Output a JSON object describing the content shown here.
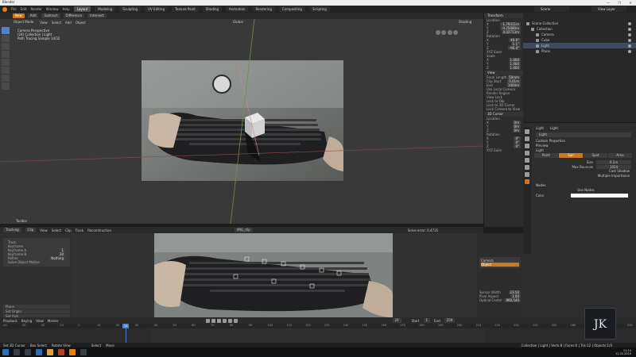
{
  "window": {
    "title": "Blender",
    "controls": [
      "—",
      "❐",
      "✕"
    ]
  },
  "menubar": {
    "menus": [
      "File",
      "Edit",
      "Render",
      "Window",
      "Help"
    ],
    "workspaces": [
      "Layout",
      "Modeling",
      "Sculpting",
      "UV Editing",
      "Texture Paint",
      "Shading",
      "Animation",
      "Rendering",
      "Compositing",
      "Scripting"
    ],
    "active_workspace": "Layout",
    "scene": "Scene",
    "view_layer": "View Layer"
  },
  "viewport_header": {
    "mode": "Object Mode",
    "menus": [
      "View",
      "Select",
      "Add",
      "Object"
    ],
    "transform": "Global",
    "shading": "Shading"
  },
  "viewport": {
    "info_lines": [
      "Camera Perspective",
      "(24) Collection | Light",
      "Path Tracing Sample 14/32"
    ],
    "toolbar_label": "Toolbar"
  },
  "npanel": {
    "sections": [
      {
        "title": "Transform",
        "rows": [
          {
            "label": "Location",
            "value": ""
          },
          {
            "label": "X",
            "value": "-1.79311m"
          },
          {
            "label": "Y",
            "value": "-0.25080m"
          },
          {
            "label": "Z",
            "value": "0.02713m"
          },
          {
            "label": "Rotation",
            "value": ""
          },
          {
            "label": "X",
            "value": "49.6°"
          },
          {
            "label": "Y",
            "value": "1.1°"
          },
          {
            "label": "Z",
            "value": "-96.4°"
          },
          {
            "label": "XYZ Euler",
            "value": ""
          },
          {
            "label": "Scale",
            "value": ""
          },
          {
            "label": "X",
            "value": "1.000"
          },
          {
            "label": "Y",
            "value": "1.000"
          },
          {
            "label": "Z",
            "value": "1.000"
          }
        ]
      },
      {
        "title": "View",
        "rows": [
          {
            "label": "Focal Length",
            "value": "50mm"
          },
          {
            "label": "Clip Start",
            "value": "0.01m"
          },
          {
            "label": "End",
            "value": "1000m"
          },
          {
            "label": "Use Local Camera",
            "value": ""
          },
          {
            "label": "Render Region",
            "value": ""
          },
          {
            "label": "View Lock",
            "value": ""
          },
          {
            "label": "Lock to Obj",
            "value": ""
          },
          {
            "label": "Lock to 3D Cursor",
            "value": ""
          },
          {
            "label": "Lock Camera to View",
            "value": ""
          }
        ]
      },
      {
        "title": "3D Cursor",
        "rows": [
          {
            "label": "Location",
            "value": ""
          },
          {
            "label": "X",
            "value": "0m"
          },
          {
            "label": "Y",
            "value": "0m"
          },
          {
            "label": "Z",
            "value": "0m"
          },
          {
            "label": "Rotation",
            "value": ""
          },
          {
            "label": "X",
            "value": "0°"
          },
          {
            "label": "Y",
            "value": "0°"
          },
          {
            "label": "Z",
            "value": "0°"
          },
          {
            "label": "XYZ Euler",
            "value": ""
          }
        ]
      }
    ]
  },
  "outliner": {
    "rows": [
      {
        "name": "Scene Collection",
        "indent": 0,
        "selected": false
      },
      {
        "name": "Collection",
        "indent": 1,
        "selected": false
      },
      {
        "name": "Camera",
        "indent": 2,
        "selected": false
      },
      {
        "name": "Cube",
        "indent": 2,
        "selected": false
      },
      {
        "name": "Light",
        "indent": 2,
        "selected": true
      },
      {
        "name": "Plane",
        "indent": 2,
        "selected": false
      }
    ]
  },
  "properties": {
    "breadcrumb_object": "Light",
    "breadcrumb_data": "Light",
    "datablock": "Light",
    "panels": [
      "Custom Properties",
      "Preview",
      "Light"
    ],
    "light_types": [
      "Point",
      "Sun",
      "Spot",
      "Area"
    ],
    "active_light_type": "Sun",
    "rows": [
      {
        "label": "Size",
        "value": "0.1m"
      },
      {
        "label": "Max Bounces",
        "value": "1024"
      }
    ],
    "checks": [
      "Cast Shadow",
      "Multiple Importance"
    ],
    "nodes_panel": "Nodes",
    "use_nodes_label": "Use Nodes",
    "color_label": "Color"
  },
  "clip_editor": {
    "header_items": [
      "Tracking",
      "Clip",
      "View",
      "Select",
      "Clip",
      "Track",
      "Reconstruction"
    ],
    "clip_name": "IMG_clip",
    "solve_error": "Solve error: 0.4735",
    "left_panel_rows": [
      "Track",
      "Keyframe",
      "Keyframe A",
      "Keyframe B",
      "Refine",
      "Solve Object Motion"
    ],
    "left_panel_values": [
      "",
      "",
      "1",
      "30",
      "Nothing",
      ""
    ],
    "bottom_rows": [
      "Plane",
      "Set Origin",
      "Set Axis"
    ],
    "right_panel_items": [
      "Camera",
      "Object"
    ],
    "right_panel_rows": [
      {
        "label": "Sensor Width",
        "value": "23.50"
      },
      {
        "label": "Pixel Aspect",
        "value": "1.00"
      },
      {
        "label": "Optical Center",
        "value": "960,540"
      }
    ]
  },
  "timeline_header": {
    "items": [
      "Playback",
      "Keying",
      "View",
      "Marker"
    ],
    "current_frame": "24",
    "start_label": "Start",
    "start": "1",
    "end_label": "End",
    "end": "250"
  },
  "timeline": {
    "ticks": [
      "-40",
      "-30",
      "-20",
      "-10",
      "0",
      "10",
      "20",
      "30",
      "40",
      "50",
      "60",
      "70",
      "80",
      "90",
      "100",
      "110",
      "120",
      "130",
      "140",
      "150",
      "160",
      "170",
      "180",
      "190",
      "200",
      "210",
      "220",
      "230",
      "240",
      "250",
      "260",
      "270",
      "280",
      "290"
    ],
    "cursor": "24"
  },
  "statusbar": {
    "items": [
      "Set 3D Cursor",
      "Box Select",
      "Rotate View",
      "Select",
      "Move"
    ],
    "stats": "Collection | Light | Verts:8 | Faces:6 | Tris:12 | Objects:1/4"
  },
  "taskbar": {
    "time": "11:14",
    "date": "11.05.2019"
  },
  "logo": {
    "text": "JK"
  },
  "colors": {
    "accent": "#c77a22",
    "selection": "#4c84c9"
  }
}
